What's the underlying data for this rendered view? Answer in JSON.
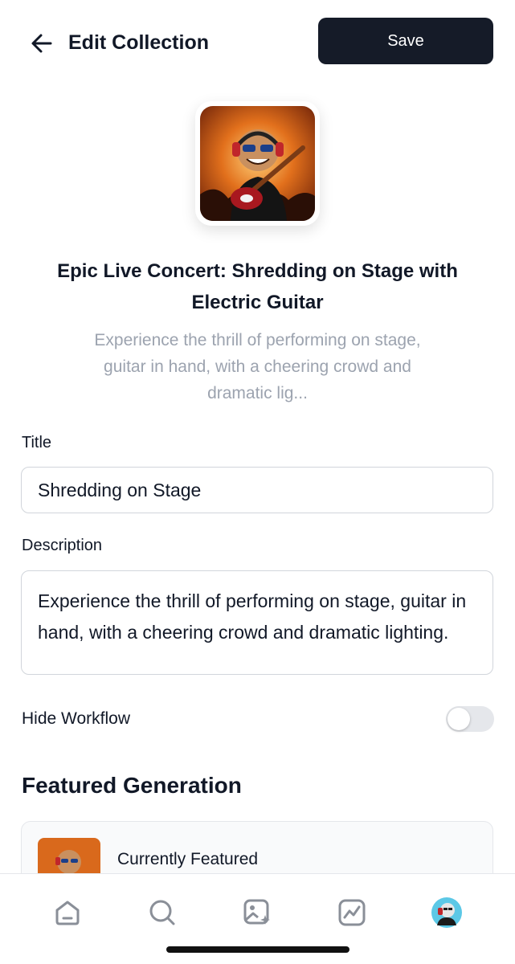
{
  "header": {
    "back_icon": "arrow-left-icon",
    "title": "Edit Collection",
    "save_label": "Save"
  },
  "collection": {
    "cover_image": "guitarist-cover-image",
    "title": "Epic Live Concert: Shredding on Stage with Electric Guitar",
    "description_preview": "Experience the thrill of performing on stage, guitar in hand, with a cheering crowd and dramatic lig..."
  },
  "form": {
    "title_label": "Title",
    "title_value": "Shredding on Stage",
    "description_label": "Description",
    "description_value": "Experience the thrill of performing on stage, guitar in hand, with a cheering crowd and dramatic lighting.",
    "hide_workflow_label": "Hide Workflow",
    "hide_workflow_enabled": false
  },
  "featured": {
    "section_title": "Featured Generation",
    "current_label": "Currently Featured"
  },
  "nav": {
    "items": [
      "home-icon",
      "search-icon",
      "create-image-icon",
      "activity-icon",
      "profile-avatar"
    ]
  },
  "colors": {
    "primary_button": "#151b28",
    "muted_text": "#9ca3af",
    "border": "#d1d5db",
    "toggle_off": "#e5e7eb"
  }
}
